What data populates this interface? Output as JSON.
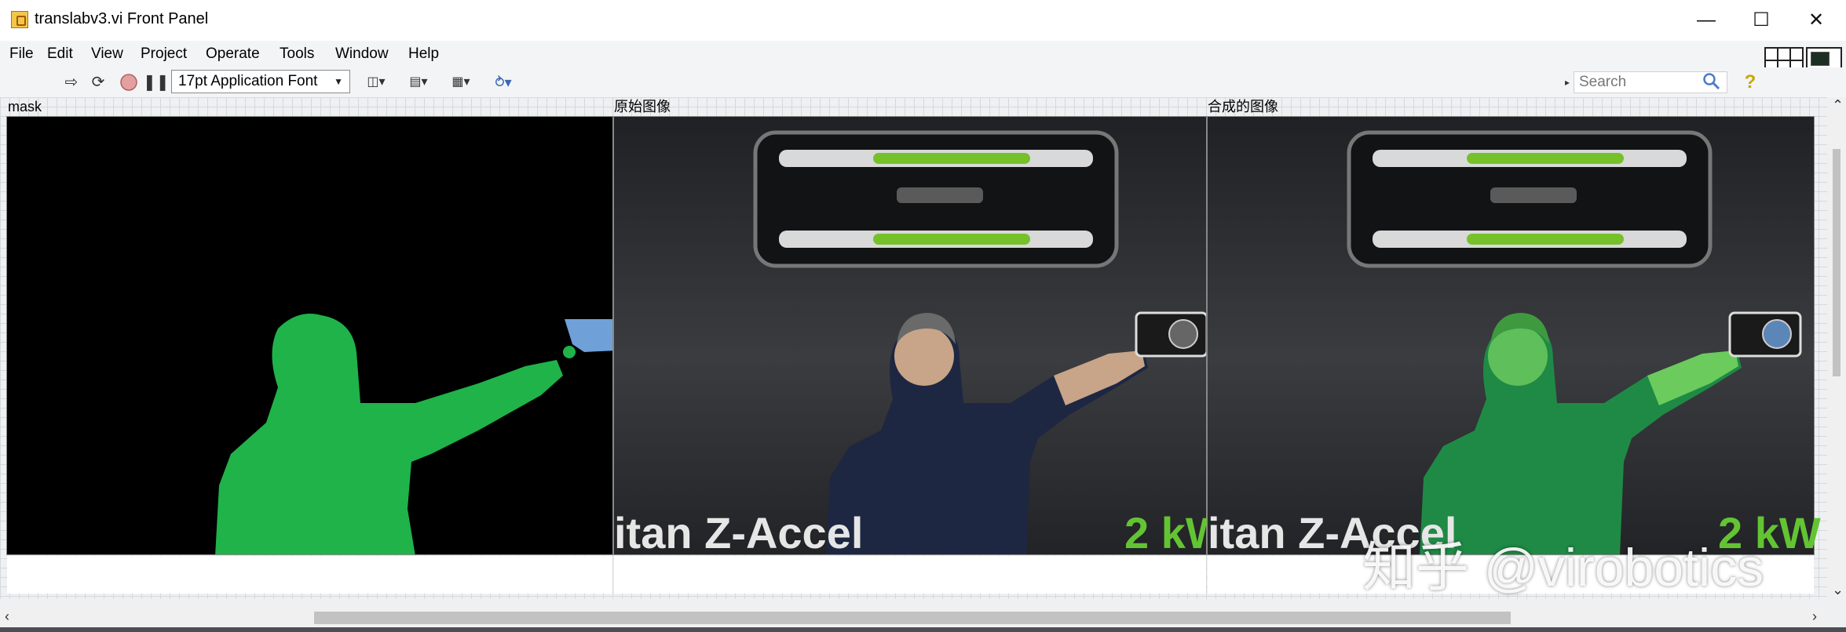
{
  "window": {
    "title": "translabv3.vi Front Panel",
    "controls": [
      "minimize",
      "maximize",
      "close"
    ]
  },
  "menu": [
    "File",
    "Edit",
    "View",
    "Project",
    "Operate",
    "Tools",
    "Window",
    "Help"
  ],
  "toolbar": {
    "font_select": "17pt Application Font",
    "search_placeholder": "Search",
    "connector_number": "1"
  },
  "displays": [
    {
      "label": "mask"
    },
    {
      "label": "原始图像",
      "text_left": "itan Z-Accel",
      "text_right": "2 kW"
    },
    {
      "label": "合成的图像",
      "text_left": "itan Z-Accel",
      "text_right": "2 kW"
    }
  ],
  "watermark": "知乎 @virobotics",
  "colors": {
    "mask_green": "#1fb34a",
    "mask_background": "#000000",
    "stage_dark": "#2a2c2f",
    "highlight_green": "#63c433"
  }
}
